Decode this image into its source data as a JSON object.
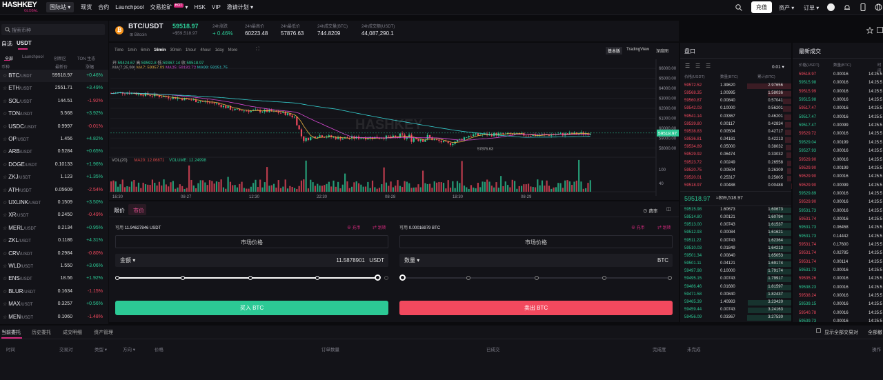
{
  "nav": {
    "logo_main": "HASHKEY",
    "logo_sub": "GLOBAL",
    "site": "国际站",
    "items": [
      "现货",
      "合约",
      "Launchpool",
      "交易挖矿",
      "HSK",
      "VIP",
      "邀请计划"
    ],
    "hot": "HOT",
    "deposit": "充值",
    "assets": "资产",
    "orders": "订单"
  },
  "side": {
    "search_placeholder": "搜索币种",
    "tabs": [
      "自选",
      "USDT"
    ],
    "subtabs": [
      "全部",
      "Launchpool",
      "创新区",
      "TON 生态"
    ],
    "headers": [
      "币种",
      "最新价",
      "涨幅"
    ],
    "pairs": [
      [
        "BTC",
        "/USDT",
        "59518.97",
        "+0.46%"
      ],
      [
        "ETH",
        "/USDT",
        "2551.71",
        "+3.49%"
      ],
      [
        "SOL",
        "/USDT",
        "144.51",
        "-1.92%"
      ],
      [
        "TON",
        "/USDT",
        "5.568",
        "+3.92%"
      ],
      [
        "USDC",
        "/USDT",
        "0.9997",
        "-0.01%"
      ],
      [
        "OP",
        "/USDT",
        "1.456",
        "+4.82%"
      ],
      [
        "ARB",
        "/USDT",
        "0.5284",
        "+0.65%"
      ],
      [
        "DOGE",
        "/USDT",
        "0.10133",
        "+1.96%"
      ],
      [
        "ZKJ",
        "/USDT",
        "1.123",
        "+1.35%"
      ],
      [
        "ATH",
        "/USDT",
        "0.05609",
        "-2.54%"
      ],
      [
        "UXLINK",
        "/USDT",
        "0.1509",
        "+3.50%"
      ],
      [
        "XR",
        "/USDT",
        "0.2450",
        "-0.49%"
      ],
      [
        "MERL",
        "/USDT",
        "0.2134",
        "+0.95%"
      ],
      [
        "ZKL",
        "/USDT",
        "0.1186",
        "+4.31%"
      ],
      [
        "CRV",
        "/USDT",
        "0.2984",
        "-0.80%"
      ],
      [
        "WLD",
        "/USDT",
        "1.550",
        "+3.06%"
      ],
      [
        "ENS",
        "/USDT",
        "18.56",
        "+1.92%"
      ],
      [
        "BLUR",
        "/USDT",
        "0.1634",
        "-1.15%"
      ],
      [
        "MAX",
        "/USDT",
        "0.3257",
        "+0.56%"
      ],
      [
        "MEN",
        "/USDT",
        "0.1060",
        "-1.48%"
      ]
    ]
  },
  "ticker": {
    "pair": "BTC/USDT",
    "name": "Bitcoin",
    "price": "59518.97",
    "price_usd": "≈$59,518.97",
    "change_label": "24h涨跌",
    "change": "+ 0.46%",
    "high_label": "24h最高价",
    "high": "60223.48",
    "low_label": "24h最低价",
    "low": "57876.63",
    "vol_label": "24h成交量(BTC)",
    "vol": "744.8209",
    "amt_label": "24h成交额(USDT)",
    "amt": "44,087,290.1"
  },
  "chart": {
    "intervals": [
      "Time",
      "1min",
      "6min",
      "16min",
      "30min",
      "1hour",
      "4hour",
      "1day",
      "More"
    ],
    "active_interval": "16min",
    "views": [
      "基本版",
      "TradingView",
      "深度图"
    ],
    "ohlc": {
      "open_l": "开:",
      "open": "59424.67",
      "high_l": "高:",
      "high": "59592.8",
      "low_l": "低:",
      "low": "59367.14",
      "close_l": "收:",
      "close": "59518.97"
    },
    "ma_label": "MA(7,25,99)",
    "ma7": "MA7: 59357.03",
    "ma25": "MA25: 59182.72",
    "ma99": "MA99: 59251.75",
    "vol_label": "VOL(20)",
    "ma20": "MA20: 12.06871",
    "vol_val": "VOLUME: 12.24998",
    "yticks": [
      "66000.00",
      "65000.00",
      "64000.00",
      "63000.00",
      "62000.00",
      "61000.00",
      "60000.00",
      "59000.00",
      "58000.00"
    ],
    "vyticks": [
      "100",
      "40"
    ],
    "xticks": [
      "16:30",
      "08-27",
      "12:30",
      "22:30",
      "08-28",
      "18:30",
      "08-29"
    ],
    "current": "59518.97",
    "low_mark": "57876.63",
    "watermark": "HASHKEY"
  },
  "order": {
    "tabs": [
      "限价",
      "市价"
    ],
    "fee": "费率",
    "avail_label": "可用",
    "buy_avail": "11.94627846 USDT",
    "sell_avail": "0.00016979 BTC",
    "charge": "充币",
    "transfer": "划转",
    "market_price": "市场价格",
    "amount_label": "金额",
    "amount_value": "11.5878901",
    "amount_unit": "USDT",
    "qty_label": "数量",
    "qty_unit": "BTC",
    "buy_btn": "买入 BTC",
    "sell_btn": "卖出 BTC"
  },
  "book": {
    "title": "盘口",
    "precision": "0.01",
    "headers": [
      "价格(USDT)",
      "数量(BTC)",
      "累计(BTC)"
    ],
    "asks": [
      [
        "59572.52",
        "1.39620",
        "2.97656"
      ],
      [
        "59568.35",
        "1.00995",
        "1.58036"
      ],
      [
        "59560.87",
        "0.00840",
        "0.57041"
      ],
      [
        "59542.03",
        "0.10000",
        "0.56201"
      ],
      [
        "59541.14",
        "0.03367",
        "0.46201"
      ],
      [
        "59539.80",
        "0.00117",
        "0.42834"
      ],
      [
        "59538.83",
        "0.00504",
        "0.42717"
      ],
      [
        "59536.81",
        "0.04181",
        "0.42213"
      ],
      [
        "59534.89",
        "0.05000",
        "0.38032"
      ],
      [
        "59529.92",
        "0.06474",
        "0.33032"
      ],
      [
        "59523.72",
        "0.00249",
        "0.26558"
      ],
      [
        "59520.75",
        "0.00504",
        "0.26309"
      ],
      [
        "59520.01",
        "0.25317",
        "0.25805"
      ],
      [
        "59518.97",
        "0.00488",
        "0.00488"
      ]
    ],
    "mid": "59518.97",
    "mid_usd": "≈$59,518.97",
    "bids": [
      [
        "59515.98",
        "1.60673",
        "1.60673"
      ],
      [
        "59514.80",
        "0.00121",
        "1.60794"
      ],
      [
        "59513.00",
        "0.00743",
        "1.61537"
      ],
      [
        "59512.93",
        "0.00084",
        "1.61621"
      ],
      [
        "59511.22",
        "0.00743",
        "1.62364"
      ],
      [
        "59510.03",
        "0.01849",
        "1.64213"
      ],
      [
        "59501.34",
        "0.00840",
        "1.65053"
      ],
      [
        "59501.11",
        "0.04121",
        "1.69174"
      ],
      [
        "59497.98",
        "0.10000",
        "1.79174"
      ],
      [
        "59495.15",
        "0.00743",
        "1.79917"
      ],
      [
        "59486.46",
        "0.01680",
        "1.81597"
      ],
      [
        "59471.58",
        "0.00840",
        "1.82437"
      ],
      [
        "59465.39",
        "1.40983",
        "3.23420"
      ],
      [
        "59459.44",
        "0.00743",
        "3.24163"
      ],
      [
        "59456.09",
        "0.03367",
        "3.27530"
      ]
    ]
  },
  "trades": {
    "title": "最新成交",
    "headers": [
      "价格(USDT)",
      "数量(BTC)",
      "时间"
    ],
    "rows": [
      [
        "59518.97",
        "0.00016",
        "14:25:5"
      ],
      [
        "59515.98",
        "0.00016",
        "14:25:5"
      ],
      [
        "59515.99",
        "0.00016",
        "14:25:5"
      ],
      [
        "59515.98",
        "0.00016",
        "14:25:5"
      ],
      [
        "59517.47",
        "0.00016",
        "14:25:5"
      ],
      [
        "59517.47",
        "0.00016",
        "14:25:5"
      ],
      [
        "59517.47",
        "0.00099",
        "14:25:5"
      ],
      [
        "59529.72",
        "0.00016",
        "14:25:5"
      ],
      [
        "59529.04",
        "0.00199",
        "14:25:5"
      ],
      [
        "59527.93",
        "0.00016",
        "14:25:5"
      ],
      [
        "59529.90",
        "0.00016",
        "14:25:5"
      ],
      [
        "59529.90",
        "0.00199",
        "14:25:5"
      ],
      [
        "59529.90",
        "0.00016",
        "14:25:5"
      ],
      [
        "59529.90",
        "0.00099",
        "14:25:5"
      ],
      [
        "59529.89",
        "0.00016",
        "14:25:5"
      ],
      [
        "59529.90",
        "0.00016",
        "14:25:5"
      ],
      [
        "59531.73",
        "0.00016",
        "14:25:5"
      ],
      [
        "59531.74",
        "0.00016",
        "14:25:5"
      ],
      [
        "59531.73",
        "0.06458",
        "14:25:5"
      ],
      [
        "59531.73",
        "0.14442",
        "14:25:5"
      ],
      [
        "59531.74",
        "0.17600",
        "14:25:5"
      ],
      [
        "59531.74",
        "0.02785",
        "14:25:5"
      ],
      [
        "59531.74",
        "0.00114",
        "14:25:5"
      ],
      [
        "59531.73",
        "0.00016",
        "14:25:5"
      ],
      [
        "59535.26",
        "0.00016",
        "14:25:5"
      ],
      [
        "59538.23",
        "0.00016",
        "14:25:5"
      ],
      [
        "59538.24",
        "0.00016",
        "14:25:5"
      ],
      [
        "59539.15",
        "0.00016",
        "14:25:5"
      ],
      [
        "59540.78",
        "0.00016",
        "14:25:5"
      ],
      [
        "59539.73",
        "0.00016",
        "14:25:5"
      ],
      [
        "59539.74",
        "0.00016",
        "14:25:5"
      ]
    ],
    "dirs": [
      "d",
      "u",
      "d",
      "u",
      "d",
      "u",
      "u",
      "d",
      "u",
      "u",
      "d",
      "d",
      "d",
      "d",
      "u",
      "d",
      "u",
      "d",
      "u",
      "u",
      "d",
      "d",
      "d",
      "u",
      "d",
      "u",
      "d",
      "u",
      "d",
      "u",
      "d"
    ]
  },
  "bottom": {
    "tabs": [
      "当前委托",
      "历史委托",
      "成交明细",
      "资产管理"
    ],
    "show_all": "显示全部交易对",
    "all_cancel": "全部撤",
    "cols": [
      "时间",
      "交易对",
      "类型",
      "方向",
      "价格",
      "订单数量",
      "已成交",
      "完成度",
      "未完成",
      "操作"
    ]
  },
  "colors": {
    "up": "#2cc995",
    "down": "#f2495e",
    "accent": "#d52a7e",
    "buy": "#2cc995",
    "sell": "#f2495e"
  }
}
